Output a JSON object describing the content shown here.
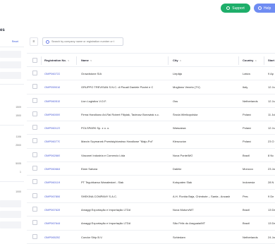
{
  "header": {
    "support_label": "Support",
    "help_label": "Help"
  },
  "page": {
    "title": "es"
  },
  "sidebar": {
    "reset_label": "Reset",
    "values": [
      "1509",
      "1500",
      "1106",
      "2500",
      "5005",
      "1",
      "1000"
    ]
  },
  "search": {
    "placeholder": "Search by company name or registration number or t"
  },
  "filter_icon": "filter-icon",
  "table": {
    "columns": [
      "Registration No.",
      "Name",
      "City",
      "Country",
      "Start"
    ],
    "rows": [
      {
        "reg": "OMP060722",
        "name": "Growdstone SIA",
        "city": "Liepāja",
        "country": "Latvia",
        "start": "9 Ap"
      },
      {
        "reg": "OMP059016",
        "name": "GRUPPO TREVISAN S.N.C. di Pauali Daniele Pizzini e C",
        "city": "Mogliano Veneto (TV)",
        "country": "Italy",
        "start": "12 Ju"
      },
      {
        "reg": "OMP060515",
        "name": "Lion Logistics V.O.F.",
        "city": "Oss",
        "country": "Netherlands",
        "start": "12 Ju"
      },
      {
        "reg": "OMP060009",
        "name": "Firma Handlowo Ari-Rai Robert Filipiak, Tadeusz Borowiak s.c.",
        "city": "Środa Wielkopolska",
        "country": "Poland",
        "start": "11 Jul"
      },
      {
        "reg": "OMP060123",
        "name": "POLSPARK Sp. z o. o.",
        "city": "Warszawa",
        "country": "Poland",
        "start": "12 Ju"
      },
      {
        "reg": "OMP060770",
        "name": "Marcin Szymanek Przedsiębiorstwo Handlowe \"Majo-Pol\"",
        "city": "Kleszczów",
        "country": "Poland",
        "start": "23 O"
      },
      {
        "reg": "OMP062669",
        "name": "Viaconei Industria e Comercio Ltda",
        "city": "Nova Ponte/MG",
        "country": "Brazil",
        "start": "8 No"
      },
      {
        "reg": "OMP060664",
        "name": "Elam Sahara",
        "city": "Dakhla",
        "country": "Morocco",
        "start": "23 Ja"
      },
      {
        "reg": "OMP060119",
        "name": "PT Teguhkarsa Wanalestari - Slak",
        "city": "Kotupaten Slak",
        "country": "Indonesia",
        "start": "28 N"
      },
      {
        "reg": "OMP067806",
        "name": "SHEKINA COMPANY S.A.C.",
        "city": "A.H. Florida Baja, Chimbote – Santa - Ancash",
        "country": "Peru",
        "start": "9 De"
      },
      {
        "reg": "OMP067628",
        "name": "Amaggi Exportação e Importação LTDA",
        "city": "Nova Mutum/MT",
        "country": "Brazil",
        "start": "13 De"
      },
      {
        "reg": "OMP067644",
        "name": "Amaggi Exportação e Importação LTDA",
        "city": "São Félix do Araguaia/MT",
        "country": "Brazil",
        "start": "13 De"
      },
      {
        "reg": "OMP065252",
        "name": "Condor Ship B.V.",
        "city": "Schiedam",
        "country": "Netherlands",
        "start": "24 Ja"
      }
    ]
  },
  "colors": {
    "support": "#1eae6a",
    "help": "#6f8cf2",
    "link": "#4a5bd4"
  }
}
